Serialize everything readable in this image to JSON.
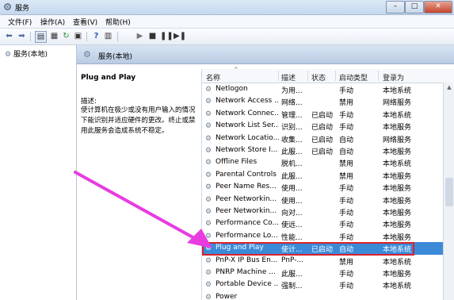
{
  "window": {
    "title": "服务",
    "min_label": "–",
    "max_label": "□",
    "close_label": "✕"
  },
  "menu": [
    "文件(F)",
    "操作(A)",
    "查看(V)",
    "帮助(H)"
  ],
  "tree": {
    "root": "服务(本地)"
  },
  "header": {
    "title": "服务(本地)"
  },
  "description": {
    "service_name": "Plug and Play",
    "label": "描述:",
    "text": "使计算机在极少或没有用户输入的情况下能识别并适应硬件的更改。终止或禁用此服务会造成系统不稳定。"
  },
  "columns": [
    "名称",
    "描述",
    "状态",
    "启动类型",
    "登录为"
  ],
  "rows": [
    {
      "name": "Netlogon",
      "desc": "为用...",
      "status": "",
      "startup": "手动",
      "logon": "本地系统"
    },
    {
      "name": "Network Access ...",
      "desc": "网络...",
      "status": "",
      "startup": "禁用",
      "logon": "网络服务"
    },
    {
      "name": "Network Connec...",
      "desc": "管理...",
      "status": "已启动",
      "startup": "手动",
      "logon": "本地系统"
    },
    {
      "name": "Network List Ser...",
      "desc": "识别...",
      "status": "已启动",
      "startup": "手动",
      "logon": "本地服务"
    },
    {
      "name": "Network Locatio...",
      "desc": "收集...",
      "status": "已启动",
      "startup": "自动",
      "logon": "网络服务"
    },
    {
      "name": "Network Store I...",
      "desc": "此服...",
      "status": "已启动",
      "startup": "自动",
      "logon": "本地服务"
    },
    {
      "name": "Offline Files",
      "desc": "脱机...",
      "status": "",
      "startup": "禁用",
      "logon": "本地系统"
    },
    {
      "name": "Parental Controls",
      "desc": "此服...",
      "status": "",
      "startup": "禁用",
      "logon": "本地服务"
    },
    {
      "name": "Peer Name Res...",
      "desc": "使用...",
      "status": "",
      "startup": "手动",
      "logon": "本地服务"
    },
    {
      "name": "Peer Networkin...",
      "desc": "使用...",
      "status": "",
      "startup": "手动",
      "logon": "本地服务"
    },
    {
      "name": "Peer Networkin...",
      "desc": "向对...",
      "status": "",
      "startup": "手动",
      "logon": "本地服务"
    },
    {
      "name": "Performance Co...",
      "desc": "使远...",
      "status": "",
      "startup": "手动",
      "logon": "本地服务"
    },
    {
      "name": "Performance Lo...",
      "desc": "性能...",
      "status": "",
      "startup": "手动",
      "logon": "本地服务"
    },
    {
      "name": "Plug and Play",
      "desc": "使计...",
      "status": "已启动",
      "startup": "自动",
      "logon": "本地系统"
    },
    {
      "name": "PnP-X IP Bus En...",
      "desc": "PnP-...",
      "status": "",
      "startup": "禁用",
      "logon": "本地系统"
    },
    {
      "name": "PNRP Machine ...",
      "desc": "此服...",
      "status": "",
      "startup": "手动",
      "logon": "本地服务"
    },
    {
      "name": "Portable Device ...",
      "desc": "强制...",
      "status": "",
      "startup": "手动",
      "logon": "本地系统"
    },
    {
      "name": "Power",
      "desc": "",
      "status": "",
      "startup": "",
      "logon": ""
    }
  ],
  "selected_row": 13,
  "colors": {
    "selection": "#3b8ad8",
    "highlight_box": "#d8222b",
    "arrow": "#e83ce0"
  }
}
